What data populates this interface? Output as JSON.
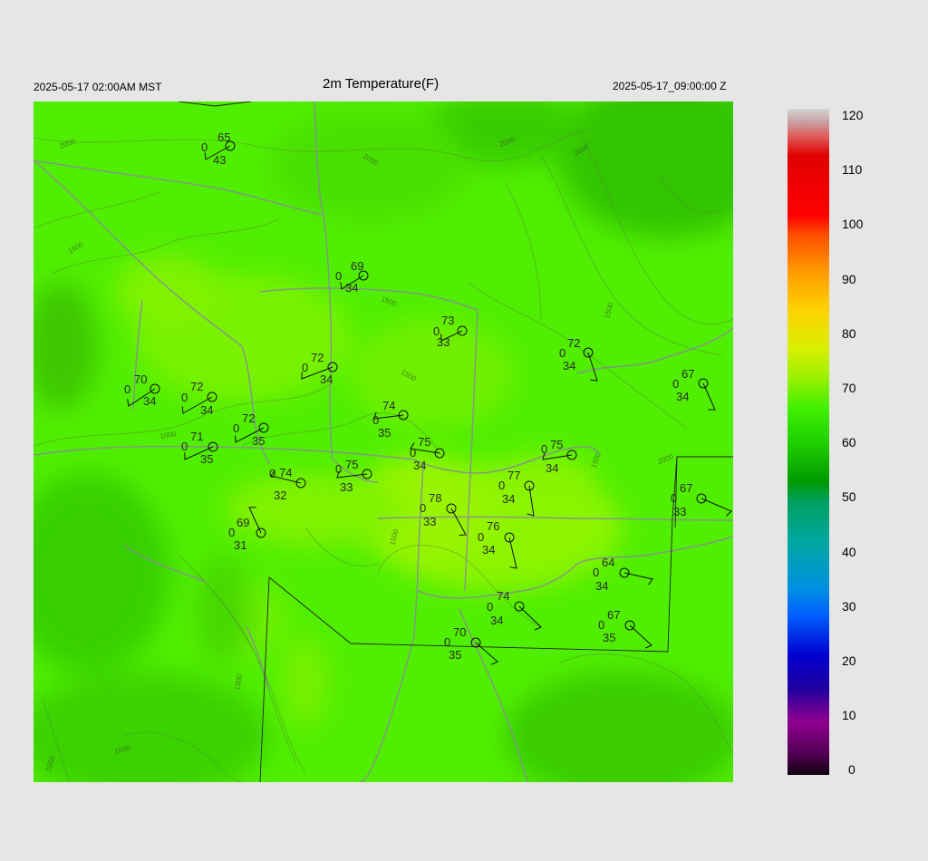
{
  "header": {
    "local_time": "2025-05-17 02:00AM MST",
    "title": "2m Temperature(F)",
    "utc_time": "2025-05-17_09:00:00 Z"
  },
  "colorbar": {
    "labels": [
      "120",
      "110",
      "100",
      "90",
      "80",
      "70",
      "60",
      "50",
      "40",
      "30",
      "20",
      "10",
      "0"
    ],
    "colors": [
      "#cfcfcf",
      "#e08080",
      "#e00000",
      "#ff4000",
      "#ffa000",
      "#ffd000",
      "#c8ff00",
      "#50f000",
      "#00b000",
      "#00a080",
      "#00a0a0",
      "#00a0ff",
      "#0040ff",
      "#0000c0",
      "#300080",
      "#a000a0",
      "#200020"
    ]
  },
  "contour_labels": [
    "2000",
    "1500",
    "1500",
    "1000",
    "1500",
    "1500",
    "2000",
    "2000",
    "2000",
    "1500",
    "2000",
    "1500",
    "1500",
    "1500",
    "1500"
  ],
  "stations": [
    {
      "temp": "65",
      "cloud": "0",
      "dew": "43"
    },
    {
      "temp": "69",
      "cloud": "0",
      "dew": "34"
    },
    {
      "temp": "73",
      "cloud": "0",
      "dew": "33"
    },
    {
      "temp": "72",
      "cloud": "0",
      "dew": "34"
    },
    {
      "temp": "72",
      "cloud": "0",
      "dew": "34"
    },
    {
      "temp": "70",
      "cloud": "0",
      "dew": "34"
    },
    {
      "temp": "72",
      "cloud": "0",
      "dew": "34"
    },
    {
      "temp": "67",
      "cloud": "0",
      "dew": "34"
    },
    {
      "temp": "74",
      "cloud": "0",
      "dew": "35"
    },
    {
      "temp": "72",
      "cloud": "0",
      "dew": "35"
    },
    {
      "temp": "71",
      "cloud": "0",
      "dew": "35"
    },
    {
      "temp": "75",
      "cloud": "0",
      "dew": "34"
    },
    {
      "temp": "75",
      "cloud": "0",
      "dew": "34"
    },
    {
      "temp": "74",
      "cloud": "0",
      "dew": "32"
    },
    {
      "temp": "75",
      "cloud": "0",
      "dew": "33"
    },
    {
      "temp": "77",
      "cloud": "0",
      "dew": "34"
    },
    {
      "temp": "67",
      "cloud": "0",
      "dew": "33"
    },
    {
      "temp": "78",
      "cloud": "0",
      "dew": "33"
    },
    {
      "temp": "69",
      "cloud": "0",
      "dew": "31"
    },
    {
      "temp": "76",
      "cloud": "0",
      "dew": "34"
    },
    {
      "temp": "64",
      "cloud": "0",
      "dew": "34"
    },
    {
      "temp": "74",
      "cloud": "0",
      "dew": "34"
    },
    {
      "temp": "67",
      "cloud": "0",
      "dew": "35"
    },
    {
      "temp": "70",
      "cloud": "0",
      "dew": "35"
    }
  ]
}
